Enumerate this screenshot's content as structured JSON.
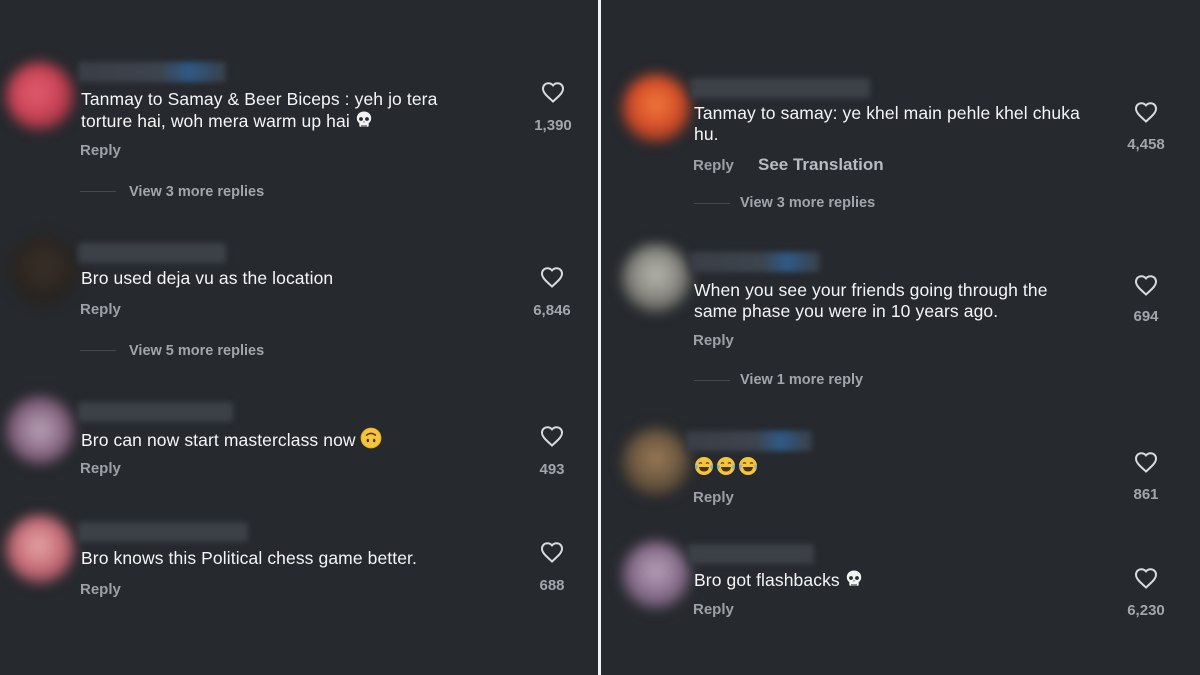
{
  "left": {
    "comments": [
      {
        "text_lines": [
          "Tanmay to Samay & Beer Biceps : yeh jo tera",
          "torture hai, woh mera warm up hai"
        ],
        "emoji": "skull-emoji",
        "reply": "Reply",
        "more_replies": "View 3 more replies",
        "likes": "1,390"
      },
      {
        "text_lines": [
          "Bro used deja vu as the location"
        ],
        "reply": "Reply",
        "more_replies": "View 5 more replies",
        "likes": "6,846"
      },
      {
        "text_lines": [
          "Bro can now start masterclass now"
        ],
        "emoji": "upside-down-face-emoji",
        "reply": "Reply",
        "likes": "493"
      },
      {
        "text_lines": [
          "Bro knows this Political chess game better."
        ],
        "reply": "Reply",
        "likes": "688"
      }
    ]
  },
  "right": {
    "comments": [
      {
        "text_lines": [
          "Tanmay to samay: ye khel main pehle khel chuka",
          "hu."
        ],
        "reply": "Reply",
        "see_translation": "See Translation",
        "more_replies": "View 3 more replies",
        "likes": "4,458"
      },
      {
        "text_lines": [
          "When you see your friends going through the",
          "same phase you were in 10 years ago."
        ],
        "reply": "Reply",
        "more_replies": "View 1 more reply",
        "likes": "694"
      },
      {
        "text_lines": [
          ""
        ],
        "emoji": "tears-of-joy-emoji x3",
        "reply": "Reply",
        "likes": "861"
      },
      {
        "text_lines": [
          "Bro got flashbacks"
        ],
        "emoji": "skull-emoji",
        "reply": "Reply",
        "likes": "6,230"
      }
    ]
  },
  "colors": {
    "background": "#26292e",
    "divider": "#f4f4f4",
    "text": "#f5f5f5",
    "muted": "#a2a6ac"
  }
}
